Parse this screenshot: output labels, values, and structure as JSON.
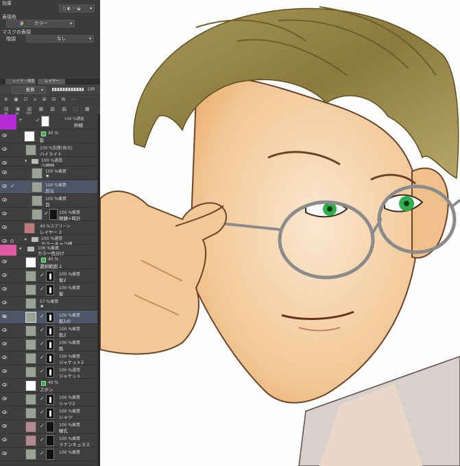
{
  "panel": {
    "effect_label": "効果",
    "display_color_label": "表現色",
    "display_color_value": "カラー",
    "mask_display_label": "マスクの表現",
    "tone_label": "階調",
    "tone_value": "なし",
    "tabs": [
      "レイヤー検索",
      "レイヤー"
    ],
    "blend_mode": "乗算",
    "opacity": "100"
  },
  "layers": [
    {
      "mode": "100 %通過",
      "name": "枠線",
      "type": "folder",
      "selected": false
    },
    {
      "mode": "40 %",
      "name": "影",
      "type": "layer",
      "selected": false
    },
    {
      "mode": "100 %加算(発光)",
      "name": "ハイライト",
      "type": "layer",
      "selected": false
    },
    {
      "mode": "100 %通過",
      "name": "小物他",
      "type": "folder",
      "selected": false
    },
    {
      "mode": "100 %乗算",
      "name": "★",
      "type": "layer",
      "selected": false
    },
    {
      "mode": "100 %乗算",
      "name": "目元",
      "type": "layer",
      "selected": true
    },
    {
      "mode": "100 %乗算",
      "name": "目",
      "type": "layer",
      "selected": false
    },
    {
      "mode": "100 %乗算",
      "name": "眼鏡+時計",
      "type": "layer",
      "selected": false
    },
    {
      "mode": "40 %スクリーン",
      "name": "レイヤー 2",
      "type": "layer",
      "selected": false
    },
    {
      "mode": "100 %通常",
      "name": "カラーキャラ線",
      "type": "folder",
      "selected": false
    },
    {
      "mode": "100 %乗算",
      "name": "カラー色分け",
      "type": "folder",
      "selected": false
    },
    {
      "mode": "40 %",
      "name": "選択範囲 2",
      "type": "layer",
      "selected": false
    },
    {
      "mode": "100 %乗算",
      "name": "髪2",
      "type": "layer",
      "selected": false
    },
    {
      "mode": "100 %乗算",
      "name": "髪",
      "type": "layer",
      "selected": false
    },
    {
      "mode": "57 %乗算",
      "name": "★",
      "type": "layer",
      "selected": false
    },
    {
      "mode": "100 %乗算",
      "name": "肌1の",
      "type": "layer",
      "selected": true
    },
    {
      "mode": "100 %乗算",
      "name": "肌2",
      "type": "layer",
      "selected": false
    },
    {
      "mode": "100 %乗算",
      "name": "肌",
      "type": "layer",
      "selected": false
    },
    {
      "mode": "100 %乗算",
      "name": "ジャケット2",
      "type": "layer",
      "selected": false
    },
    {
      "mode": "100 %通常",
      "name": "ジャケット",
      "type": "layer",
      "selected": false
    },
    {
      "mode": "40 %",
      "name": "ズボン",
      "type": "layer",
      "selected": false
    },
    {
      "mode": "100 %乗算",
      "name": "シャツ2",
      "type": "layer",
      "selected": false
    },
    {
      "mode": "100 %乗算",
      "name": "シャツ",
      "type": "layer",
      "selected": false
    },
    {
      "mode": "100 %乗算",
      "name": "瞳孔",
      "type": "layer",
      "selected": false
    },
    {
      "mode": "100 %乗算",
      "name": "ラナンキュラス",
      "type": "layer",
      "selected": false
    },
    {
      "mode": "100 %乗算",
      "name": "",
      "type": "layer",
      "selected": false
    }
  ],
  "colors": {
    "panel_bg": "#3b3b3b",
    "selected_row": "#4e5566",
    "accent_purple": "#b22bd6",
    "accent_pink": "#e05aa0"
  }
}
